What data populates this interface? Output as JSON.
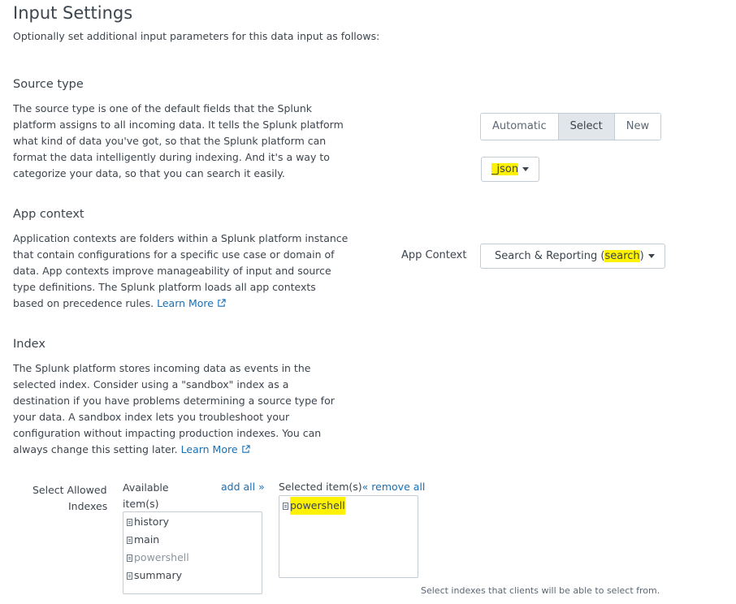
{
  "page": {
    "title": "Input Settings",
    "subtitle": "Optionally set additional input parameters for this data input as follows:"
  },
  "source_type": {
    "heading": "Source type",
    "description_lines": [
      "The source type is one of the default fields that the Splunk",
      "platform assigns to all incoming data. It tells the Splunk platform",
      "what kind of data you've got, so that the Splunk platform can",
      "format the data intelligently during indexing. And it's a way to",
      "categorize your data, so that you can search it easily."
    ],
    "modes": [
      "Automatic",
      "Select",
      "New"
    ],
    "active_mode": "Select",
    "selected_value": "_json"
  },
  "app_context": {
    "heading": "App context",
    "description_lines": [
      "Application contexts are folders within a Splunk platform instance",
      "that contain configurations for a specific use case or domain of",
      "data. App contexts improve manageability of input and source",
      "type definitions. The Splunk platform loads all app contexts",
      "based on precedence rules."
    ],
    "learn_more": "Learn More",
    "field_label": "App Context",
    "value_main": "Search & Reporting (",
    "value_highlight": "search",
    "value_close": ")"
  },
  "index": {
    "heading": "Index",
    "description_lines": [
      "The Splunk platform stores incoming data as events in the",
      "selected index. Consider using a \"sandbox\" index as a",
      "destination if you have problems determining a source type for",
      "your data. A sandbox index lets you troubleshoot your",
      "configuration without impacting production indexes. You can",
      "always change this setting later."
    ],
    "learn_more": "Learn More",
    "allowed_label_line1": "Select Allowed",
    "allowed_label_line2": "Indexes",
    "available_header_line1": "Available",
    "available_header_line2": "item(s)",
    "add_all": "add all »",
    "selected_header": "Selected item(s)",
    "remove_all": "« remove all",
    "available_items": [
      "history",
      "main",
      "powershell",
      "summary"
    ],
    "selected_items": [
      "powershell"
    ],
    "help_text": "Select indexes that clients will be able to select from."
  },
  "colors": {
    "link": "#1a6fb3",
    "highlight": "#fff200",
    "text": "#3c444d",
    "border": "#c3cbd4"
  }
}
